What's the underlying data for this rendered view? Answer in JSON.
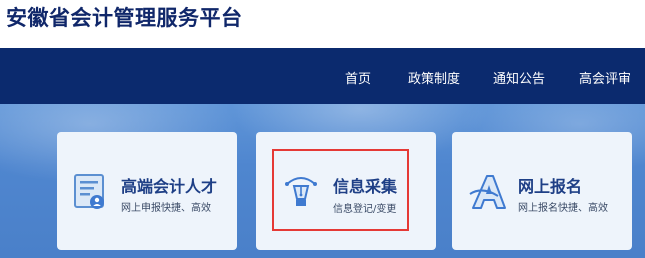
{
  "header": {
    "title": "安徽省会计管理服务平台"
  },
  "nav": {
    "items": [
      {
        "label": "首页"
      },
      {
        "label": "政策制度"
      },
      {
        "label": "通知公告"
      },
      {
        "label": "高会评审"
      }
    ]
  },
  "cards": [
    {
      "title": "高端会计人才",
      "subtitle": "网上申报快捷、高效",
      "icon": "id-card-person-icon"
    },
    {
      "title": "信息采集",
      "subtitle": "信息登记/变更",
      "icon": "pen-nib-icon"
    },
    {
      "title": "网上报名",
      "subtitle": "网上报名快捷、高效",
      "icon": "letter-a-icon"
    }
  ],
  "colors": {
    "title": "#10276a",
    "navbar": "#0b2a6e",
    "banner": "#5a8fd4",
    "card": "#eef4fb",
    "card_title": "#1e3f86",
    "highlight": "#e53935"
  }
}
